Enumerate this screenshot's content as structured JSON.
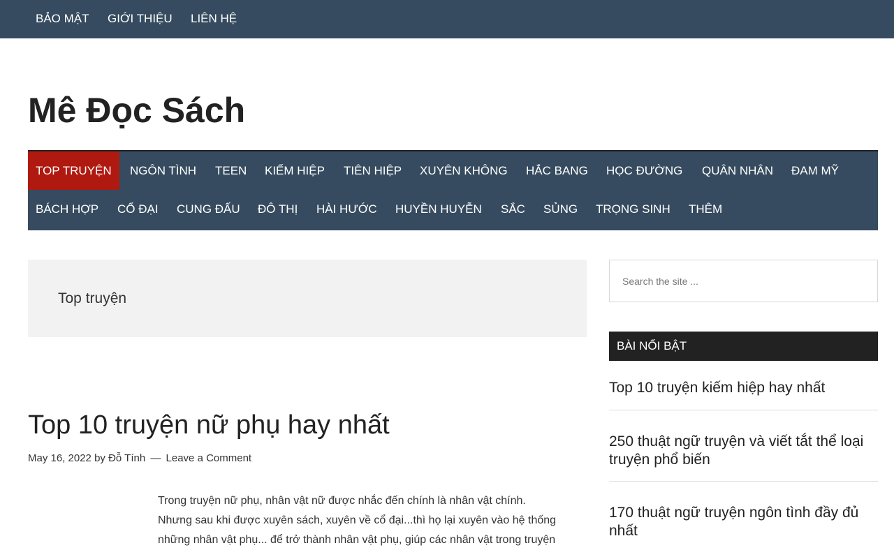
{
  "topbar": {
    "links": [
      "BẢO MẬT",
      "GIỚI THIỆU",
      "LIÊN HỆ"
    ]
  },
  "site": {
    "title": "Mê Đọc Sách"
  },
  "primary_nav": {
    "row1": [
      "TOP TRUYỆN",
      "NGÔN TÌNH",
      "TEEN",
      "KIẾM HIỆP",
      "TIÊN HIỆP",
      "XUYÊN KHÔNG",
      "HẮC BANG",
      "HỌC ĐƯỜNG",
      "QUÂN NHÂN",
      "ĐAM MỸ"
    ],
    "row2": [
      "BÁCH HỢP",
      "CỔ ĐẠI",
      "CUNG ĐẤU",
      "ĐÔ THỊ",
      "HÀI HƯỚC",
      "HUYỀN HUYỄN",
      "SẮC",
      "SỦNG",
      "TRỌNG SINH",
      "THÊM"
    ],
    "active_color": "#b0190f",
    "bar_color": "#364b5f"
  },
  "archive": {
    "title": "Top truyện"
  },
  "post": {
    "title": "Top 10 truyện nữ phụ hay nhất",
    "date": "May 16, 2022",
    "by": "by",
    "author": "Đỗ Tính",
    "separator": "—",
    "comment_link": "Leave a Comment",
    "excerpt_lines": [
      "Trong truyện nữ phụ, nhân vật nữ được nhắc đến chính là nhân vật chính.",
      "Nhưng sau khi được xuyên sách, xuyên về cổ đại...thì họ lại xuyên vào hệ thống",
      "những nhân vật phụ... để trở thành nhân vật phụ, giúp các nhân vật trong truyện"
    ]
  },
  "sidebar": {
    "search_placeholder": "Search the site ...",
    "featured_title": "BÀI NỔI BẬT",
    "featured": [
      "Top 10 truyện kiếm hiệp hay nhất",
      "250 thuật ngữ truyện và viết tắt thể loại truyện phổ biến",
      "170 thuật ngữ truyện ngôn tình đầy đủ nhất"
    ]
  }
}
